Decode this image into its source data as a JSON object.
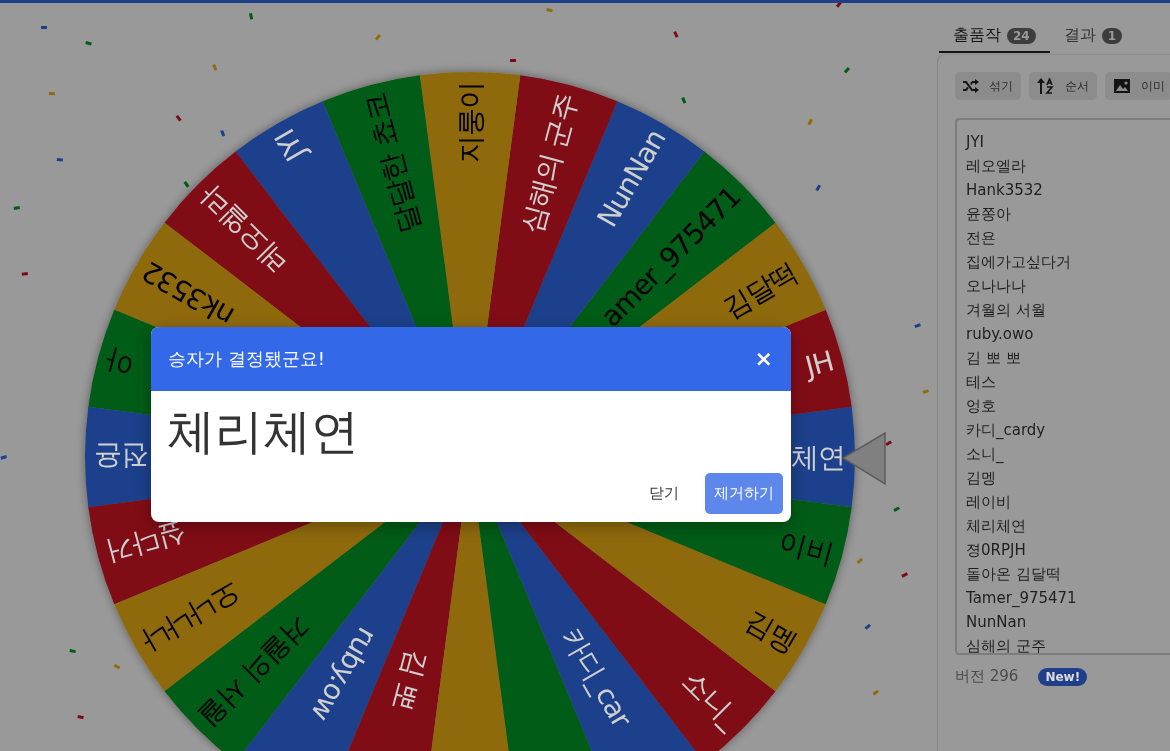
{
  "wheel": {
    "slices": [
      {
        "label": "체연",
        "color": "#1f3f8b"
      },
      {
        "label": "JH",
        "color": "#800916"
      },
      {
        "label": "김달떡",
        "color": "#8f6b0a"
      },
      {
        "label": "amer_975471",
        "color": "#005c16"
      },
      {
        "label": "NunNan",
        "color": "#1f3f8b"
      },
      {
        "label": "심해의 군주",
        "color": "#800916"
      },
      {
        "label": "지룽이",
        "color": "#8f6b0a"
      },
      {
        "label": "달달한 쵸코",
        "color": "#005c16"
      },
      {
        "label": "JYI",
        "color": "#1f3f8b"
      },
      {
        "label": "레오엘라",
        "color": "#800916"
      },
      {
        "label": "nk3532",
        "color": "#8f6b0a"
      },
      {
        "label": "아",
        "color": "#005c16"
      },
      {
        "label": "전욘",
        "color": "#1f3f8b"
      },
      {
        "label": "싶다거",
        "color": "#800916"
      },
      {
        "label": "오나나나",
        "color": "#8f6b0a"
      },
      {
        "label": "겨월의 서월",
        "color": "#005c16"
      },
      {
        "label": "ruby.ow",
        "color": "#1f3f8b"
      },
      {
        "label": "김 뽀",
        "color": "#800916"
      },
      {
        "color": "#8f6b0a"
      },
      {
        "color": "#005c16"
      },
      {
        "label": "카디_car",
        "color": "#1f3f8b"
      },
      {
        "label": "소니_",
        "color": "#800916"
      },
      {
        "label": "김멩",
        "color": "#8f6b0a"
      },
      {
        "label": "이비",
        "color": "#005c16"
      }
    ]
  },
  "panel": {
    "tabs": [
      {
        "label": "출품작",
        "count": "24",
        "selected": true
      },
      {
        "label": "결과",
        "count": "1",
        "selected": false
      }
    ],
    "tools": [
      {
        "kind": "shuffle",
        "label": "섞기"
      },
      {
        "kind": "sort",
        "label": "순서"
      },
      {
        "kind": "image",
        "label": "이미"
      }
    ],
    "entries": [
      "JYI",
      "레오엘라",
      "Hank3532",
      "윤쫑아",
      "전욘",
      "집에가고싶다거",
      "오나나나",
      "겨월의 서월",
      "ruby.owo",
      "김 뽀 뽀",
      "테스",
      "엉호",
      "카디_cardy",
      "소니_",
      "김멩",
      "레이비",
      "체리체연",
      "졍0RPJH",
      "돌아온 김달떡",
      "Tamer_975471",
      "NunNan",
      "심해의 군주"
    ],
    "version": "버전 296",
    "badge": "New!"
  },
  "dialog": {
    "title": "승자가 결정됐군요!",
    "close": "×",
    "winner": "체리체연",
    "buttons": [
      {
        "kind": "secondary",
        "label": "닫기"
      },
      {
        "kind": "primary",
        "label": "제거하기"
      }
    ]
  }
}
